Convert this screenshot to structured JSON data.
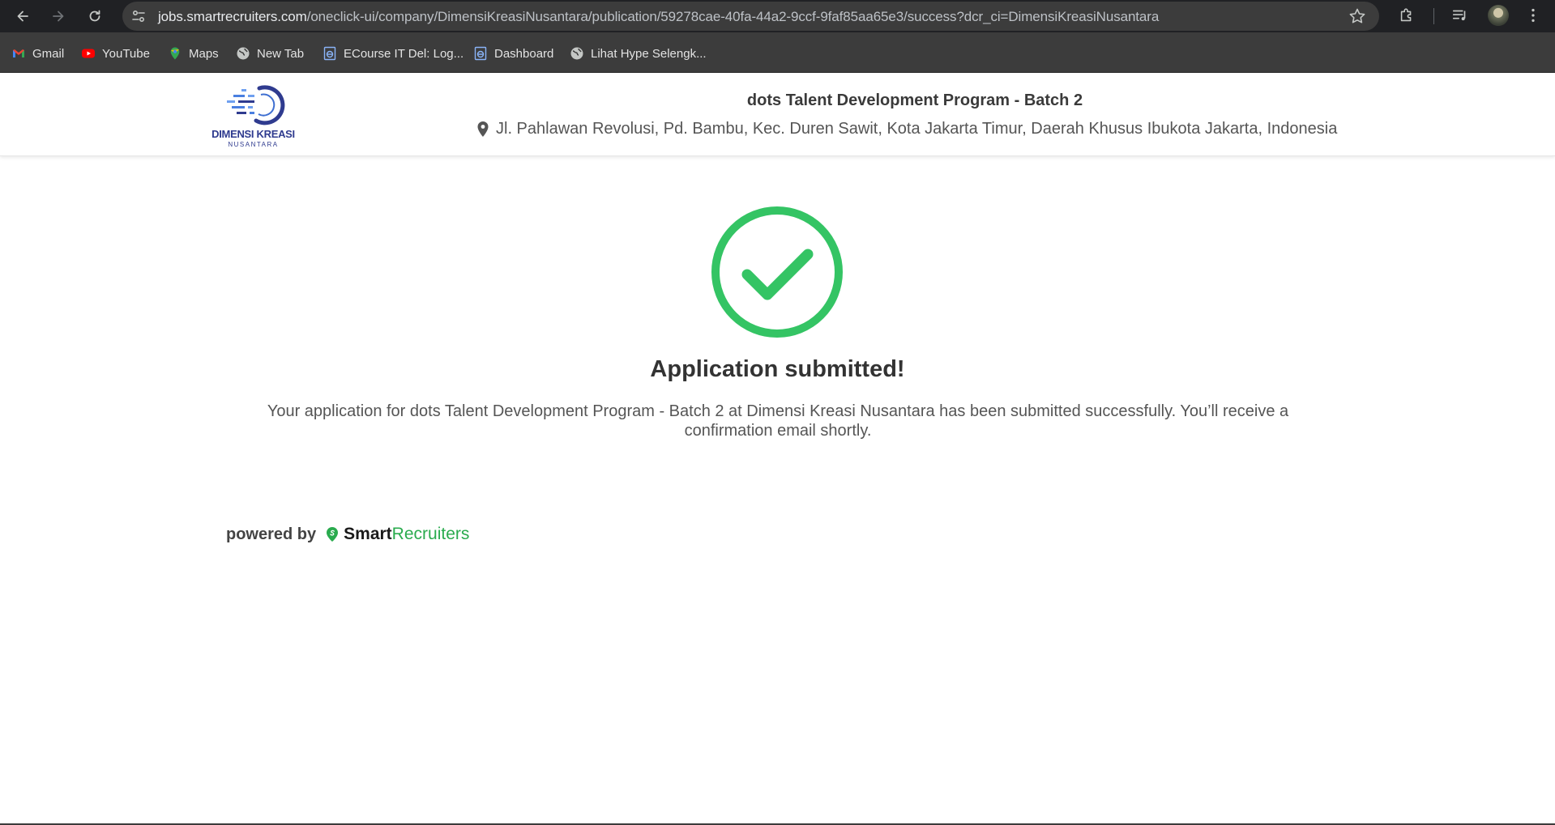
{
  "browser": {
    "url_host": "jobs.smartrecruiters.com",
    "url_path": "/oneclick-ui/company/DimensiKreasiNusantara/publication/59278cae-40fa-44a2-9ccf-9faf85aa65e3/success?dcr_ci=DimensiKreasiNusantara",
    "bookmarks": [
      {
        "label": "Gmail",
        "icon": "gmail-icon"
      },
      {
        "label": "YouTube",
        "icon": "youtube-icon"
      },
      {
        "label": "Maps",
        "icon": "maps-icon"
      },
      {
        "label": "New Tab",
        "icon": "globe-icon"
      },
      {
        "label": "ECourse IT Del: Log...",
        "icon": "ecourse-icon"
      },
      {
        "label": "Dashboard",
        "icon": "ecourse-icon"
      },
      {
        "label": "Lihat Hype Selengk...",
        "icon": "globe-icon"
      }
    ]
  },
  "header": {
    "logo_line1": "DIMENSI KREASI",
    "logo_line2": "NUSANTARA",
    "job_title": "dots Talent Development Program - Batch 2",
    "location": "Jl. Pahlawan Revolusi, Pd. Bambu, Kec. Duren Sawit, Kota Jakarta Timur, Daerah Khusus Ibukota Jakarta, Indonesia"
  },
  "success": {
    "title": "Application submitted!",
    "message": "Your application for dots Talent Development Program - Batch 2 at Dimensi Kreasi Nusantara has been submitted successfully. You’ll receive a confirmation email shortly.",
    "icon": "check-circle-icon",
    "color": "#34c464"
  },
  "footer": {
    "powered_by": "powered by",
    "brand_smart": "Smart",
    "brand_recruiters": "Recruiters",
    "brand_color": "#2aab4e"
  }
}
